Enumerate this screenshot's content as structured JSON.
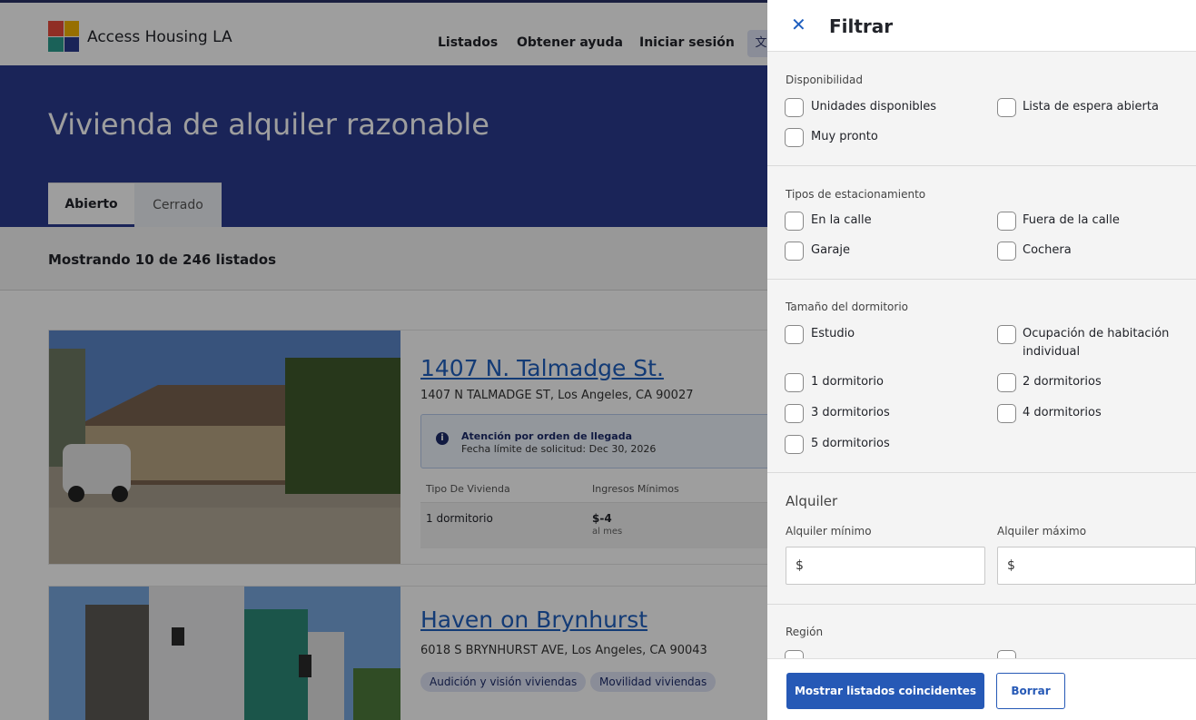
{
  "header": {
    "brand": "Access Housing LA",
    "nav": [
      "Listados",
      "Obtener ayuda",
      "Iniciar sesión"
    ],
    "language_icon": "translate-icon"
  },
  "hero": {
    "title": "Vivienda de alquiler razonable",
    "tabs": [
      "Abierto",
      "Cerrado"
    ]
  },
  "results": {
    "count_text": "Mostrando 10 de 246 listados"
  },
  "listings": [
    {
      "title": "1407 N. Talmadge St.",
      "address": "1407 N TALMADGE ST, Los Angeles, CA 90027",
      "notice_title": "Atención por orden de llegada",
      "notice_sub": "Fecha límite de solicitud: Dec 30, 2026",
      "table_headers": [
        "Tipo De Vivienda",
        "Ingresos Mínimos"
      ],
      "row": {
        "type": "1 dormitorio",
        "income": "$-4",
        "income_unit": "al mes"
      }
    },
    {
      "title": "Haven on Brynhurst",
      "address": "6018 S BRYNHURST AVE, Los Angeles, CA 90043",
      "tags": [
        "Audición y visión viviendas",
        "Movilidad viviendas"
      ]
    }
  ],
  "drawer": {
    "close_icon": "close-icon",
    "title": "Filtrar",
    "availability": {
      "label": "Disponibilidad",
      "options": [
        "Unidades disponibles",
        "Lista de espera abierta",
        "Muy pronto"
      ]
    },
    "parking": {
      "label": "Tipos de estacionamiento",
      "options": [
        "En la calle",
        "Fuera de la calle",
        "Garaje",
        "Cochera"
      ]
    },
    "bedrooms": {
      "label": "Tamaño del dormitorio",
      "options": [
        "Estudio",
        "Ocupación de habitación individual",
        "1 dormitorio",
        "2 dormitorios",
        "3 dormitorios",
        "4 dormitorios",
        "5 dormitorios"
      ]
    },
    "rent": {
      "label": "Alquiler",
      "min_label": "Alquiler mínimo",
      "max_label": "Alquiler máximo",
      "currency": "$",
      "min_value": "",
      "max_value": ""
    },
    "region": {
      "label": "Región"
    },
    "show_button": "Mostrar listados coincidentes",
    "clear_button": "Borrar"
  },
  "colors": {
    "brand_navy": "#2a3a8f",
    "link_blue": "#1f5fbf",
    "primary_button": "#2659b6"
  }
}
